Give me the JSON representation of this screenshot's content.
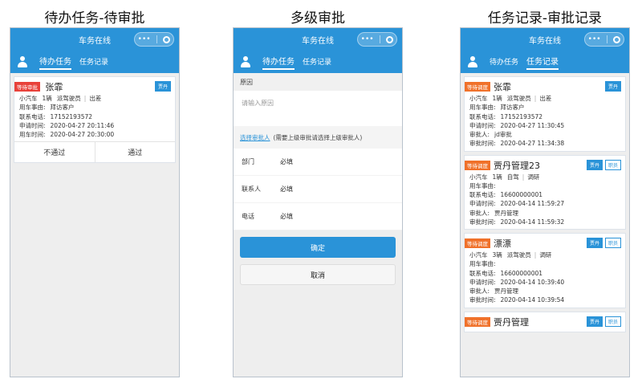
{
  "screens": [
    {
      "caption": "待办任务-待审批",
      "title": "车务在线",
      "capsule_dots": "•••",
      "tabs": [
        "待办任务",
        "任务记录"
      ],
      "card": {
        "tag": "等待审批",
        "name": "张霏",
        "badge": "贾丹",
        "vehicle": "小汽车",
        "count": "1辆",
        "driver": "派驾驶员",
        "purpose": "出差",
        "reason_label": "用车事由:",
        "reason": "拜访客户",
        "phone_label": "联系电话:",
        "phone": "17152193572",
        "apply_label": "申请时间:",
        "apply": "2020-04-27 20:11:46",
        "use_label": "用车时间:",
        "use": "2020-04-27 20:30:00",
        "reject": "不通过",
        "approve": "通过"
      }
    },
    {
      "caption": "多级审批",
      "title": "车务在线",
      "capsule_dots": "•••",
      "tabs": [
        "待办任务",
        "任务记录"
      ],
      "reason_header": "原因",
      "reason_placeholder": "请输入原因",
      "pick_link": "选择审批人",
      "pick_hint": "(需要上级审批请选择上级审批人)",
      "fields": [
        {
          "label": "部门",
          "value": "必填"
        },
        {
          "label": "联系人",
          "value": "必填"
        },
        {
          "label": "电话",
          "value": "必填"
        }
      ],
      "confirm": "确定",
      "cancel": "取消"
    },
    {
      "caption": "任务记录-审批记录",
      "title": "车务在线",
      "capsule_dots": "•••",
      "tabs": [
        "待办任务",
        "任务记录"
      ],
      "cards": [
        {
          "tag": "等待调度",
          "name": "张霏",
          "badges": [
            "贾丹"
          ],
          "vehicle": "小汽车",
          "count": "1辆",
          "driver": "派驾驶员",
          "purpose": "出差",
          "rows": [
            [
              "用车事由:",
              "拜访客户"
            ],
            [
              "联系电话:",
              "17152193572"
            ],
            [
              "申请时间:",
              "2020-04-27 11:30:45"
            ],
            [
              "审批人:",
              "jd审批"
            ],
            [
              "审批时间:",
              "2020-04-27 11:34:38"
            ]
          ]
        },
        {
          "tag": "等待调度",
          "name": "贾丹管理23",
          "badges": [
            "贾丹",
            "职员"
          ],
          "vehicle": "小汽车",
          "count": "1辆",
          "driver": "自驾",
          "purpose": "调研",
          "rows": [
            [
              "用车事由:",
              ""
            ],
            [
              "联系电话:",
              "16600000001"
            ],
            [
              "申请时间:",
              "2020-04-14 11:59:27"
            ],
            [
              "审批人:",
              "贾丹管理"
            ],
            [
              "审批时间:",
              "2020-04-14 11:59:32"
            ]
          ]
        },
        {
          "tag": "等待调度",
          "name": "漂漂",
          "badges": [
            "贾丹",
            "职员"
          ],
          "vehicle": "小汽车",
          "count": "3辆",
          "driver": "派驾驶员",
          "purpose": "调研",
          "rows": [
            [
              "用车事由:",
              ""
            ],
            [
              "联系电话:",
              "16600000001"
            ],
            [
              "申请时间:",
              "2020-04-14 10:39:40"
            ],
            [
              "审批人:",
              "贾丹管理"
            ],
            [
              "审批时间:",
              "2020-04-14 10:39:54"
            ]
          ]
        },
        {
          "tag": "等待调度",
          "name": "贾丹管理",
          "badges": [
            "贾丹",
            "职员"
          ]
        }
      ]
    }
  ],
  "colors": {
    "primary": "#2a93d8",
    "tag_orange": "#f0712a",
    "tag_red": "#e8413a"
  },
  "icons": [
    "user-icon",
    "more-dots-icon",
    "target-icon"
  ]
}
